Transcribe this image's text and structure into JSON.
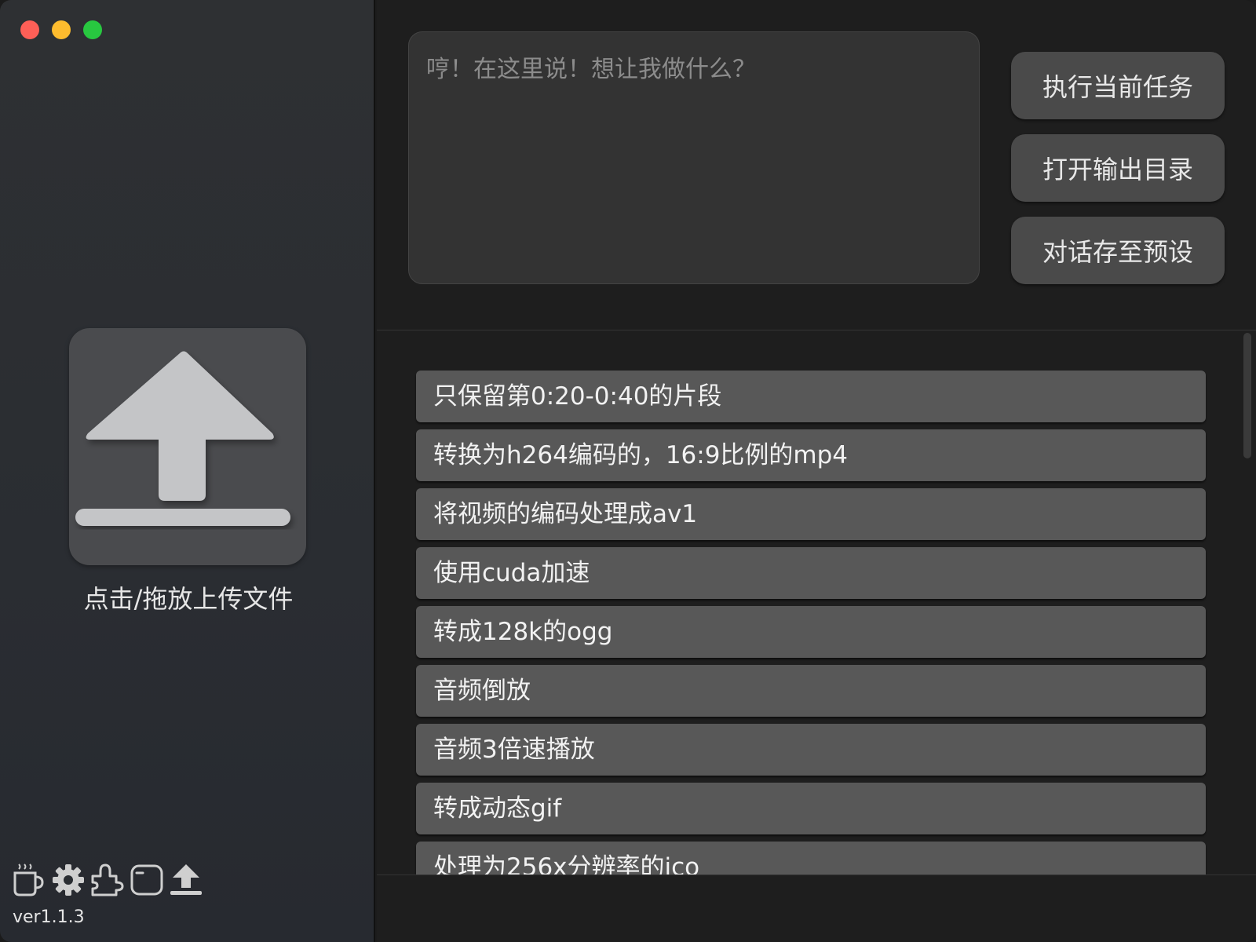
{
  "sidebar": {
    "upload_label": "点击/拖放上传文件",
    "version": "ver1.1.3",
    "icons": [
      "coffee-icon",
      "gear-icon",
      "plugin-icon",
      "terminal-icon",
      "upload-icon"
    ]
  },
  "prompt": {
    "placeholder": "哼！在这里说！想让我做什么？",
    "value": ""
  },
  "actions": {
    "execute": "执行当前任务",
    "open_output": "打开输出目录",
    "save_preset": "对话存至预设"
  },
  "presets": [
    "只保留第0:20-0:40的片段",
    "转换为h264编码的，16:9比例的mp4",
    "将视频的编码处理成av1",
    "使用cuda加速",
    "转成128k的ogg",
    "音频倒放",
    "音频3倍速播放",
    "转成动态gif",
    "处理为256x分辨率的ico"
  ],
  "colors": {
    "window_close": "#fe5f57",
    "window_minimize": "#febc2e",
    "window_zoom": "#28c840"
  }
}
